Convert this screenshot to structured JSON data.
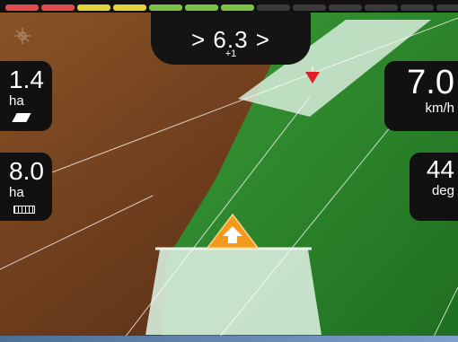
{
  "lightbar": {
    "leds": [
      "#e24b4b",
      "#e24b4b",
      "#e3d33a",
      "#e3d33a",
      "#7cc247",
      "#7cc247",
      "#7cc247",
      "#3a3a3a",
      "#3a3a3a",
      "#3a3a3a",
      "#3a3a3a",
      "#3a3a3a",
      "#3a3a3a"
    ]
  },
  "guidance": {
    "cross_track": "> 6.3 >",
    "pass_offset": "+1"
  },
  "area_total": {
    "value": "1.4",
    "unit": "ha",
    "icon": "parallelogram-icon"
  },
  "area_worked": {
    "value": "8.0",
    "unit": "ha",
    "icon": "ruler-icon"
  },
  "speed": {
    "value": "7.0",
    "unit": "km/h"
  },
  "heading": {
    "value": "44",
    "unit": "deg"
  },
  "colors": {
    "soil": "#7a4724",
    "crop": "#2f8a2c",
    "coverage": "#d7ecdc",
    "vehicle_marker": "#f39a1d",
    "waypoint_marker": "#e01f2b"
  }
}
